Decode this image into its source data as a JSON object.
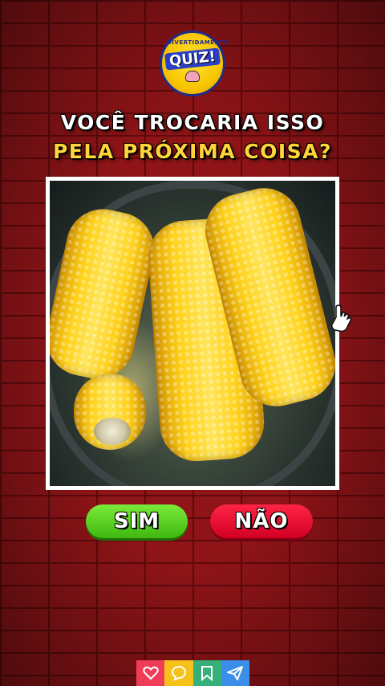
{
  "logo": {
    "top_text": "DIVERTIDAMENTE",
    "badge_text": "QUIZ!"
  },
  "question": {
    "line1": "VOCÊ TROCARIA ISSO",
    "line2": "PELA PRÓXIMA COISA?"
  },
  "image": {
    "subject": "corn-on-the-cob-boiling"
  },
  "answers": {
    "yes_label": "SIM",
    "no_label": "NÃO"
  },
  "colors": {
    "brick": "#8e1417",
    "yes": "#4cc51a",
    "no": "#e8002a",
    "title_yellow": "#ffd53a"
  },
  "bottom_bar": [
    {
      "icon": "heart-icon"
    },
    {
      "icon": "chat-icon"
    },
    {
      "icon": "bookmark-icon"
    },
    {
      "icon": "share-icon"
    }
  ]
}
